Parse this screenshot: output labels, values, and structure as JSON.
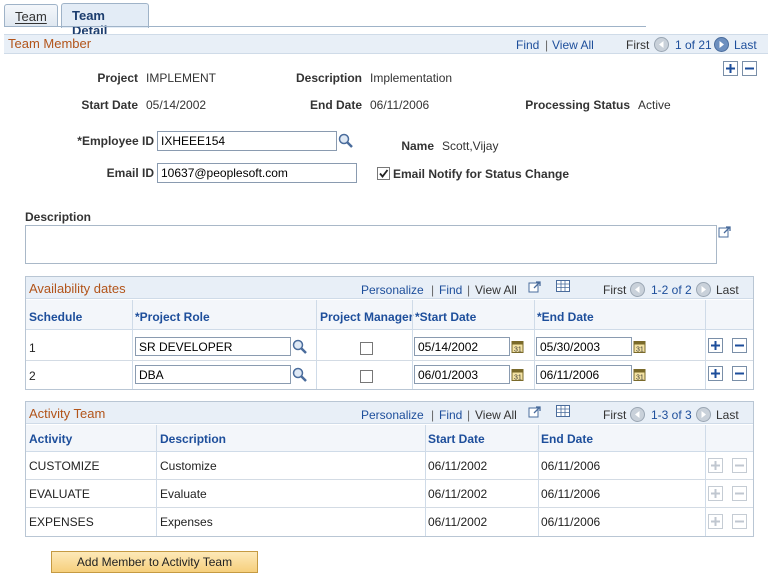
{
  "tabs": [
    {
      "label": "Team",
      "underline": "T"
    },
    {
      "label": "Team Detail"
    }
  ],
  "section": {
    "title": "Team Member",
    "find": "Find",
    "view_all": "View All",
    "first": "First",
    "range": "1 of 21",
    "last": "Last"
  },
  "fields": {
    "project_label": "Project",
    "project_value": "IMPLEMENT",
    "description_label": "Description",
    "description_value": "Implementation",
    "start_label": "Start Date",
    "start_value": "05/14/2002",
    "end_label": "End Date",
    "end_value": "06/11/2006",
    "status_label": "Processing Status",
    "status_value": "Active",
    "employee_label": "*Employee ID",
    "employee_value": "IXHEEE154",
    "name_label": "Name",
    "name_value": "Scott,Vijay",
    "email_label": "Email ID",
    "email_value": "10637@peoplesoft.com",
    "notify_label": "Email Notify for Status Change",
    "desc_area_label": "Description"
  },
  "availability": {
    "title": "Availability dates",
    "personalize": "Personalize",
    "find": "Find",
    "view_all": "View All",
    "first": "First",
    "range": "1-2 of 2",
    "last": "Last",
    "headers": [
      "Schedule",
      "*Project Role",
      "Project Manager",
      "*Start Date",
      "*End Date"
    ],
    "rows": [
      {
        "schedule": "1",
        "role": "SR DEVELOPER",
        "start": "05/14/2002",
        "end": "05/30/2003"
      },
      {
        "schedule": "2",
        "role": "DBA",
        "start": "06/01/2003",
        "end": "06/11/2006"
      }
    ]
  },
  "activity": {
    "title": "Activity Team",
    "personalize": "Personalize",
    "find": "Find",
    "view_all": "View All",
    "first": "First",
    "range": "1-3 of 3",
    "last": "Last",
    "headers": [
      "Activity",
      "Description",
      "Start Date",
      "End Date"
    ],
    "rows": [
      {
        "activity": "CUSTOMIZE",
        "description": "Customize",
        "start": "06/11/2002",
        "end": "06/11/2006"
      },
      {
        "activity": "EVALUATE",
        "description": "Evaluate",
        "start": "06/11/2002",
        "end": "06/11/2006"
      },
      {
        "activity": "EXPENSES",
        "description": "Expenses",
        "start": "06/11/2002",
        "end": "06/11/2006"
      }
    ]
  },
  "button": {
    "add_member": "Add Member to Activity Team"
  },
  "colors": {
    "section_title": "#b2541a",
    "link": "#1d4e9b",
    "button": "#f6cf7c"
  }
}
